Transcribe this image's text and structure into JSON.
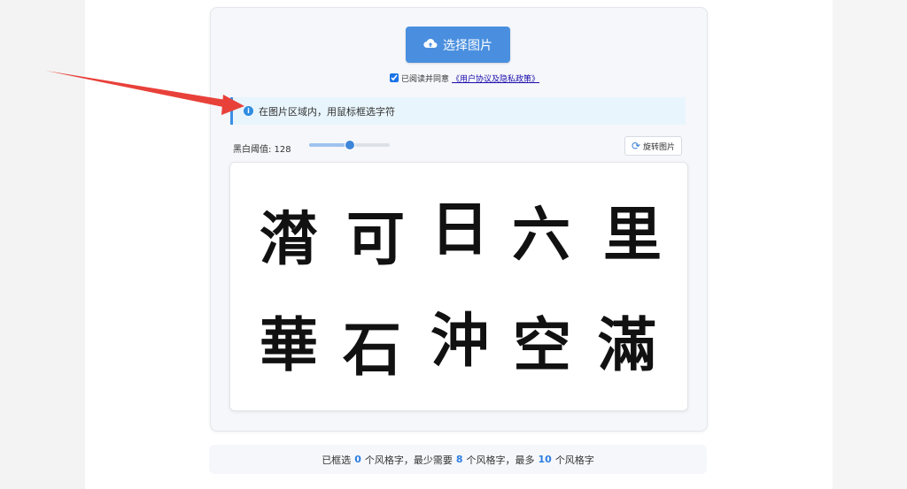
{
  "upload": {
    "label": "选择图片",
    "icon": "cloud-upload-icon"
  },
  "agreement": {
    "checked": true,
    "text": "已阅读并同意",
    "link": "《用户协议及隐私政策》"
  },
  "notice": {
    "icon": "info-icon",
    "text": "在图片区域内，用鼠标框选字符"
  },
  "threshold": {
    "label": "黑白阈值: 128",
    "value": 128,
    "max": 255
  },
  "rotate": {
    "label": "旋转图片",
    "icon": "rotate-icon"
  },
  "glyphs": [
    "潸",
    "可",
    "日",
    "六",
    "里",
    "華",
    "石",
    "沖",
    "空",
    "滿"
  ],
  "status": {
    "p1": "已框选",
    "selected": "0",
    "p2": "个风格字，最少需要",
    "min": "8",
    "p3": "个风格字，最多",
    "max": "10",
    "p4": "个风格字"
  },
  "colors": {
    "accent": "#4a8fdf",
    "link": "#1a0dab",
    "notice_bg": "#e8f5fc",
    "arrow": "#e8413a"
  }
}
